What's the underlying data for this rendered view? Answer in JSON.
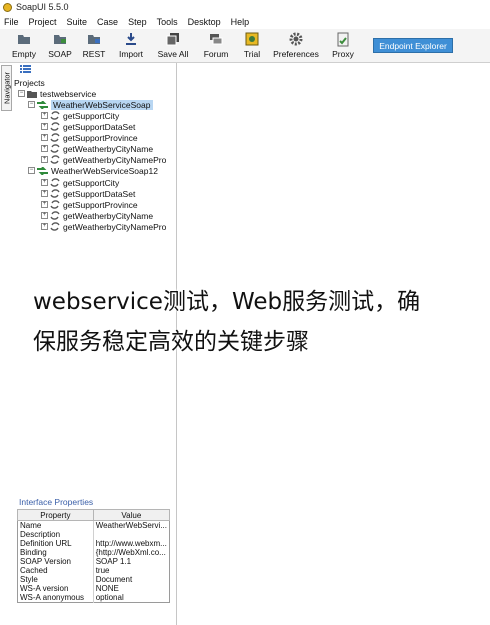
{
  "window": {
    "title": "SoapUI 5.5.0"
  },
  "menu": [
    "File",
    "Project",
    "Suite",
    "Case",
    "Step",
    "Tools",
    "Desktop",
    "Help"
  ],
  "toolbar": {
    "buttons": [
      {
        "label": "Empty",
        "icon": "empty-project-icon"
      },
      {
        "label": "SOAP",
        "icon": "soap-project-icon"
      },
      {
        "label": "REST",
        "icon": "rest-project-icon"
      },
      {
        "label": "Import",
        "icon": "import-icon"
      },
      {
        "label": "Save All",
        "icon": "save-all-icon"
      },
      {
        "label": "Forum",
        "icon": "forum-icon"
      },
      {
        "label": "Trial",
        "icon": "trial-icon"
      },
      {
        "label": "Preferences",
        "icon": "gear-icon"
      },
      {
        "label": "Proxy",
        "icon": "proxy-icon"
      }
    ],
    "endpoint_explorer": "Endpoint Explorer"
  },
  "navigator": {
    "tab_label": "Navigator"
  },
  "tree": {
    "root": "Projects",
    "project": "testwebservice",
    "interfaces": [
      {
        "name": "WeatherWebServiceSoap",
        "selected": true,
        "operations": [
          "getSupportCity",
          "getSupportDataSet",
          "getSupportProvince",
          "getWeatherbyCityName",
          "getWeatherbyCityNamePro"
        ]
      },
      {
        "name": "WeatherWebServiceSoap12",
        "selected": false,
        "operations": [
          "getSupportCity",
          "getSupportDataSet",
          "getSupportProvince",
          "getWeatherbyCityName",
          "getWeatherbyCityNamePro"
        ]
      }
    ]
  },
  "properties": {
    "title": "Interface Properties",
    "headers": [
      "Property",
      "Value"
    ],
    "rows": [
      [
        "Name",
        "WeatherWebServi..."
      ],
      [
        "Description",
        ""
      ],
      [
        "Definition URL",
        "http://www.webxm..."
      ],
      [
        "Binding",
        "{http://WebXml.co..."
      ],
      [
        "SOAP Version",
        "SOAP 1.1"
      ],
      [
        "Cached",
        "true"
      ],
      [
        "Style",
        "Document"
      ],
      [
        "WS-A version",
        "NONE"
      ],
      [
        "WS-A anonymous",
        "optional"
      ]
    ]
  },
  "overlay": {
    "line1": "webservice测试，Web服务测试，确",
    "line2": "保服务稳定高效的关键步骤"
  },
  "colors": {
    "selection": "#b8d6f2",
    "endpoint_button": "#3f8fd6",
    "properties_title": "#3a5fa8"
  }
}
